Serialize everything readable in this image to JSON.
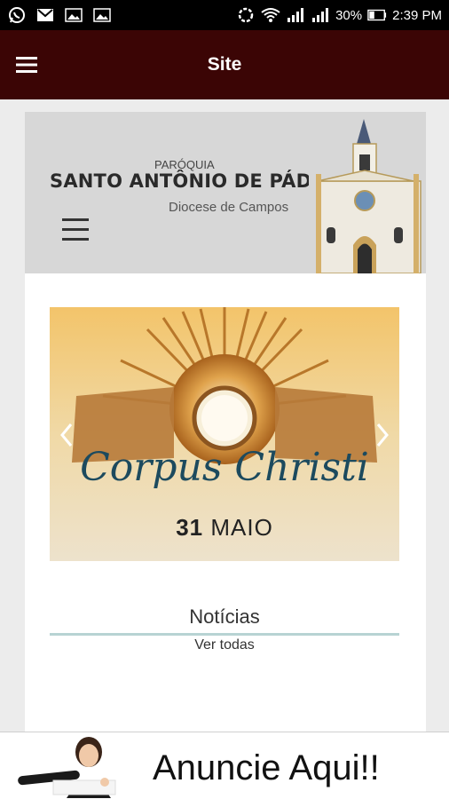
{
  "status_bar": {
    "battery": "30%",
    "time": "2:39 PM",
    "left_icons": [
      "whatsapp-icon",
      "gmail-icon",
      "image-icon",
      "image-icon"
    ],
    "right_icons": [
      "sync-icon",
      "wifi-icon",
      "signal-icon",
      "signal-icon",
      "battery-icon"
    ]
  },
  "app_bar": {
    "title": "Site",
    "menu_icon": "hamburger-menu-icon",
    "background": "#3b0505"
  },
  "site_header": {
    "pre_title": "PARÓQUIA",
    "title": "SANTO ANTÔNIO DE PÁDUA - RJ",
    "subtitle": "Diocese de Campos"
  },
  "slider": {
    "script_text": "Corpus Christi",
    "date_day": "31",
    "date_month": "MAIO"
  },
  "news": {
    "title": "Notícias",
    "link": "Ver todas"
  },
  "ad_banner": {
    "text": "Anuncie Aqui!!"
  }
}
